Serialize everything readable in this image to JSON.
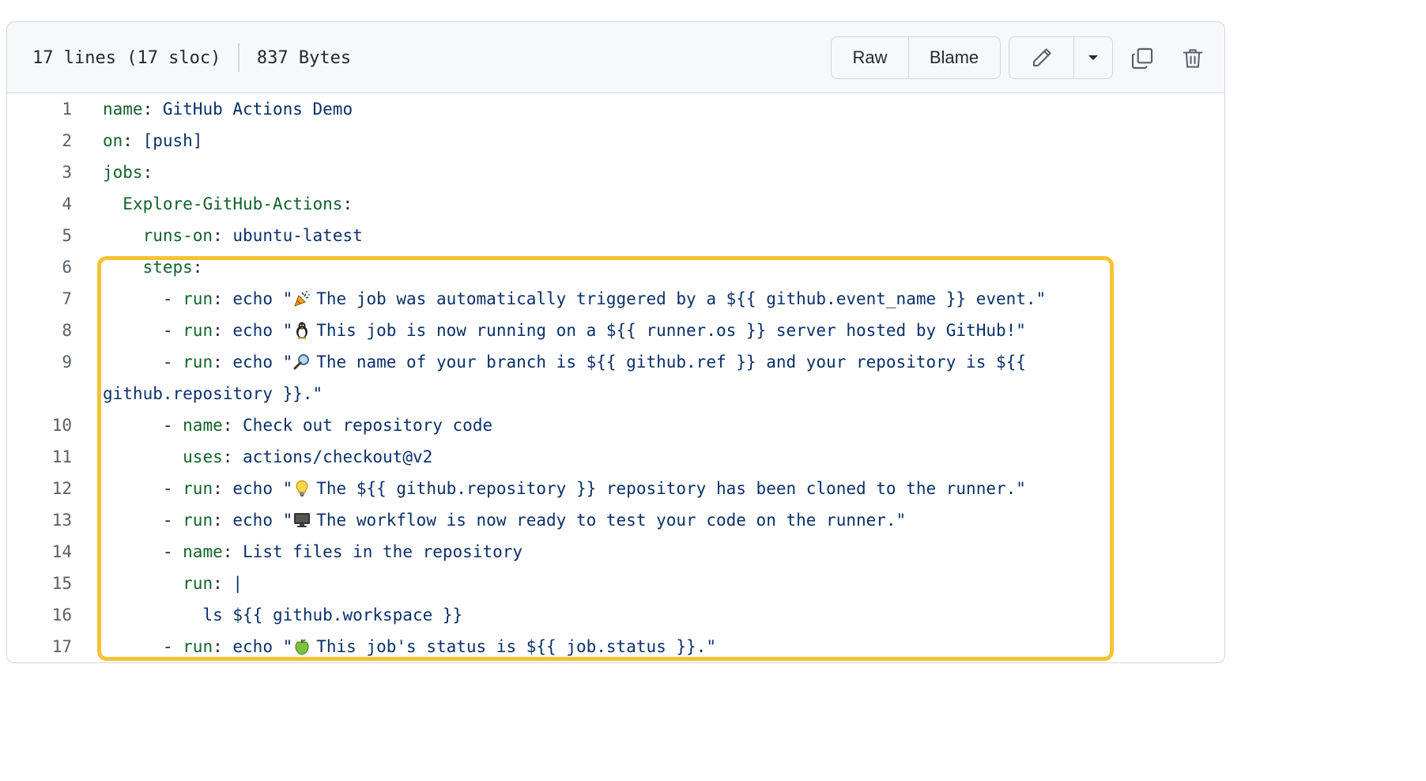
{
  "header": {
    "lines_info": "17 lines (17 sloc)",
    "size_info": "837 Bytes",
    "raw_label": "Raw",
    "blame_label": "Blame",
    "edit_icon": "pencil-icon",
    "dropdown_icon": "triangle-down-icon",
    "copy_icon": "copy-icon",
    "delete_icon": "trash-icon"
  },
  "code": {
    "lines": [
      {
        "num": "1",
        "indent": "",
        "key": "name",
        "sep": ": ",
        "value": "GitHub Actions Demo"
      },
      {
        "num": "2",
        "indent": "",
        "key": "on",
        "sep": ": ",
        "value": "[push]"
      },
      {
        "num": "3",
        "indent": "",
        "key": "jobs",
        "sep": ":",
        "value": ""
      },
      {
        "num": "4",
        "indent": "  ",
        "key": "Explore-GitHub-Actions",
        "sep": ":",
        "value": ""
      },
      {
        "num": "5",
        "indent": "    ",
        "key": "runs-on",
        "sep": ": ",
        "value": "ubuntu-latest"
      },
      {
        "num": "6",
        "indent": "    ",
        "key": "steps",
        "sep": ":",
        "value": ""
      },
      {
        "num": "7",
        "indent": "      - ",
        "key": "run",
        "sep": ": ",
        "pre": "echo \"",
        "emoji": "party-popper",
        "value": " The job was automatically triggered by a ${{ github.event_name }} event.\""
      },
      {
        "num": "8",
        "indent": "      - ",
        "key": "run",
        "sep": ": ",
        "pre": "echo \"",
        "emoji": "penguin",
        "value": " This job is now running on a ${{ runner.os }} server hosted by GitHub!\""
      },
      {
        "num": "9",
        "indent": "      - ",
        "key": "run",
        "sep": ": ",
        "pre": "echo \"",
        "emoji": "magnifying-glass",
        "value": " The name of your branch is ${{ github.ref }} and your repository is ${{"
      },
      {
        "num": "",
        "indent": "",
        "key": "",
        "sep": "",
        "value": "github.repository }}.\""
      },
      {
        "num": "10",
        "indent": "      - ",
        "key": "name",
        "sep": ": ",
        "value": "Check out repository code"
      },
      {
        "num": "11",
        "indent": "        ",
        "key": "uses",
        "sep": ": ",
        "value": "actions/checkout@v2"
      },
      {
        "num": "12",
        "indent": "      - ",
        "key": "run",
        "sep": ": ",
        "pre": "echo \"",
        "emoji": "light-bulb",
        "value": " The ${{ github.repository }} repository has been cloned to the runner.\""
      },
      {
        "num": "13",
        "indent": "      - ",
        "key": "run",
        "sep": ": ",
        "pre": "echo \"",
        "emoji": "computer",
        "value": " The workflow is now ready to test your code on the runner.\""
      },
      {
        "num": "14",
        "indent": "      - ",
        "key": "name",
        "sep": ": ",
        "value": "List files in the repository"
      },
      {
        "num": "15",
        "indent": "        ",
        "key": "run",
        "sep": ": ",
        "value": "|"
      },
      {
        "num": "16",
        "indent": "          ",
        "key": "",
        "sep": "",
        "value": "ls ${{ github.workspace }}"
      },
      {
        "num": "17",
        "indent": "      - ",
        "key": "run",
        "sep": ": ",
        "pre": "echo \"",
        "emoji": "green-apple",
        "value": " This job's status is ${{ job.status }}.\""
      }
    ]
  },
  "colors": {
    "highlight": "#f5c234",
    "key": "#116329",
    "value": "#0a3069",
    "line_number": "#57606a"
  }
}
